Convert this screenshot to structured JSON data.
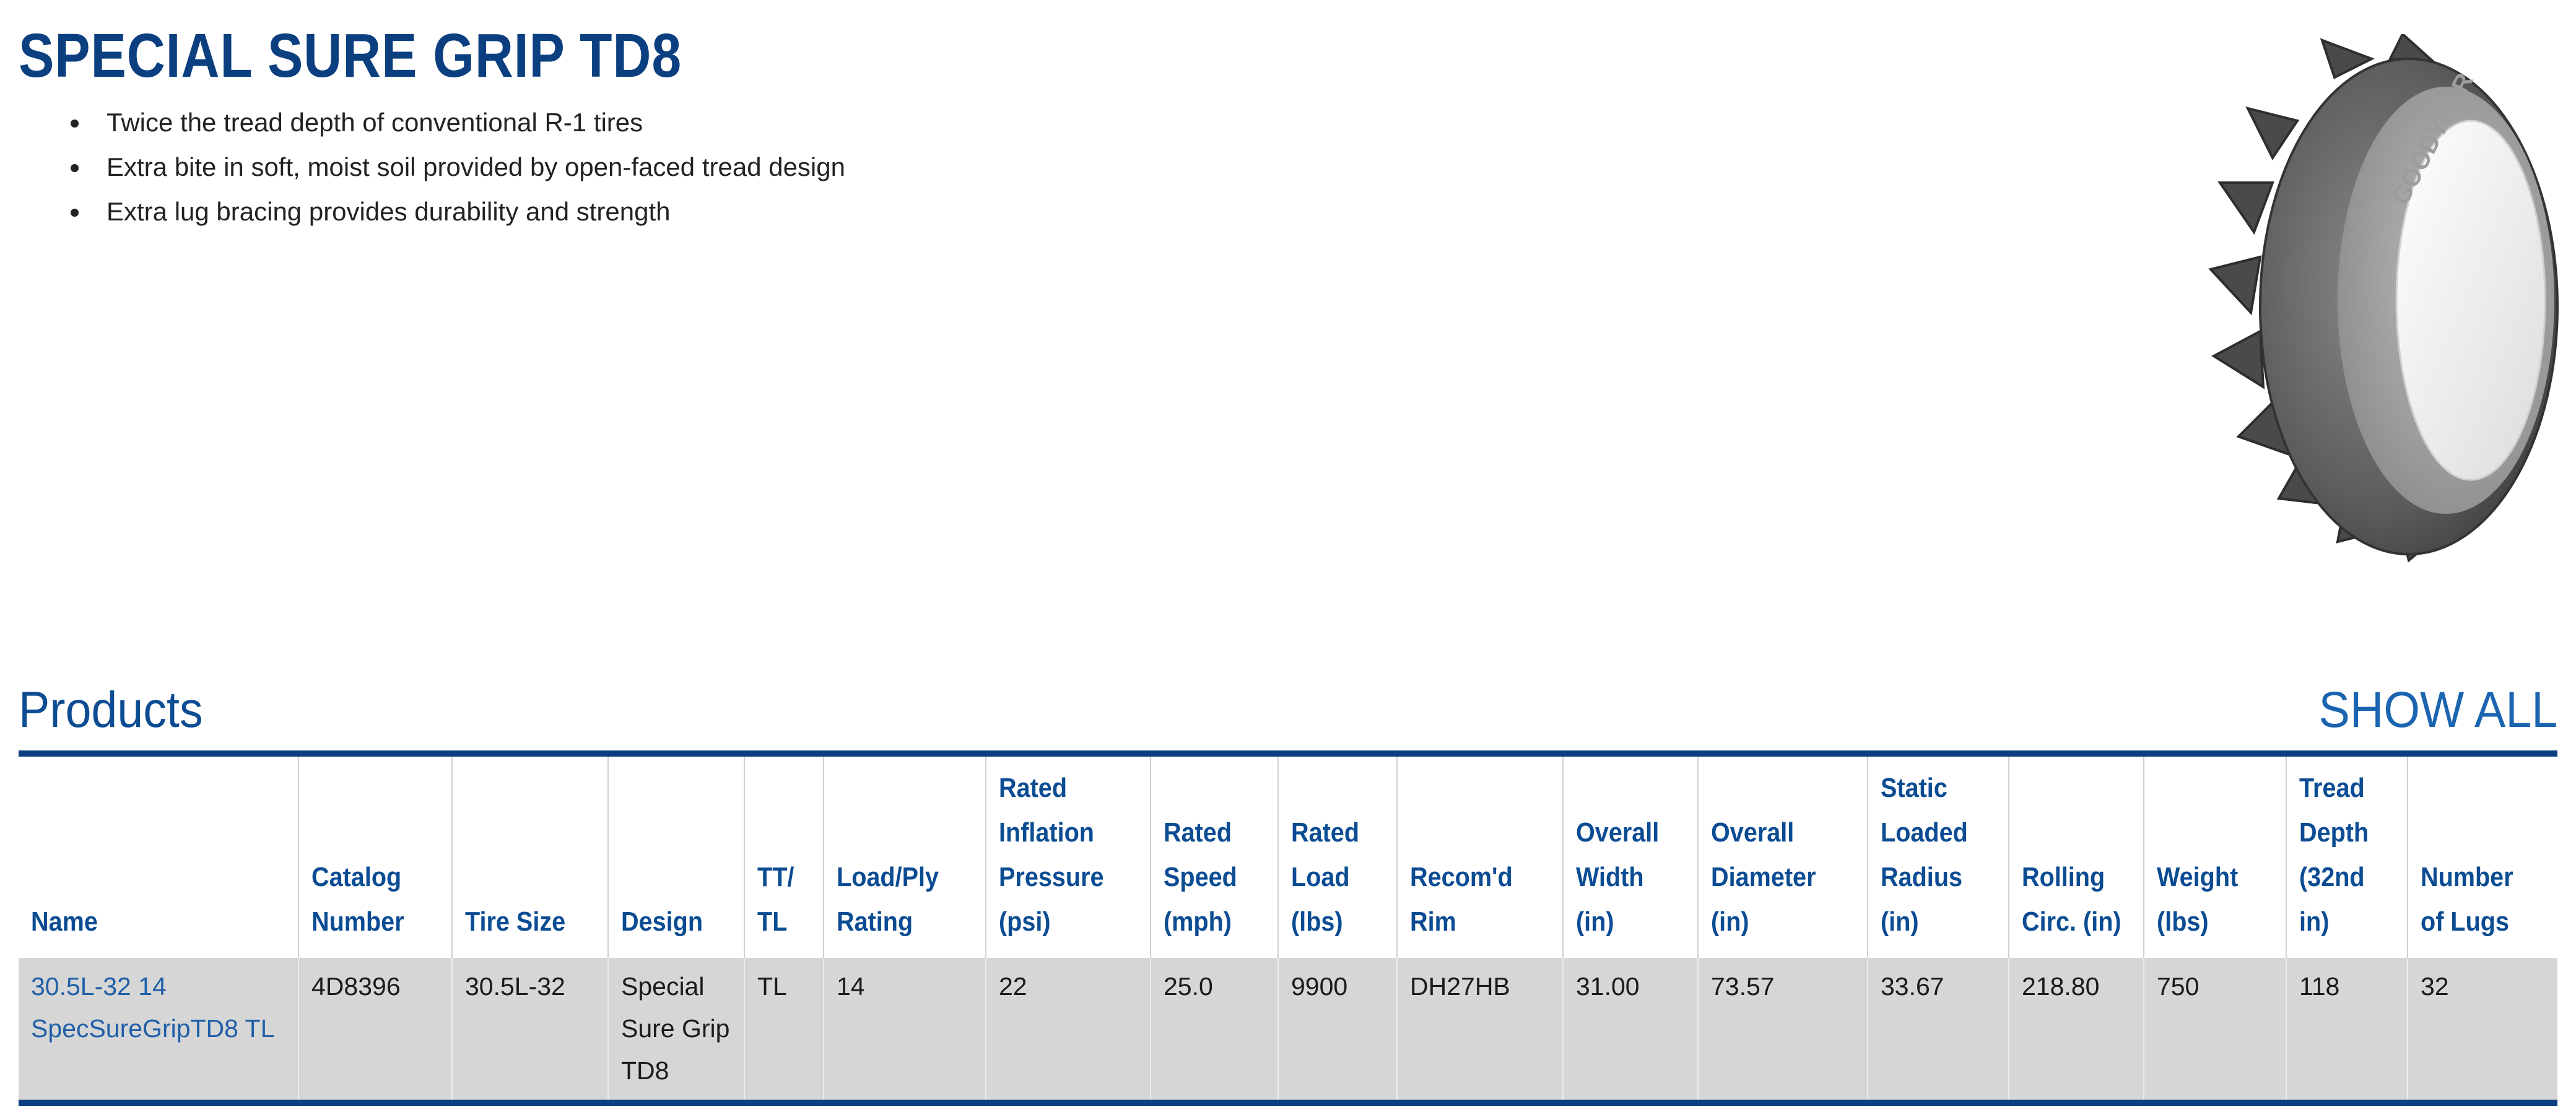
{
  "title": "SPECIAL SURE GRIP TD8",
  "features": [
    "Twice the tread depth of conventional R-1 tires",
    "Extra bite in soft, moist soil provided by open-faced tread design",
    "Extra lug bracing provides durability and strength"
  ],
  "image": {
    "icon": "tire-image",
    "sidewall_text": "GOODYEAR"
  },
  "products": {
    "heading": "Products",
    "show_all_label": "SHOW ALL",
    "columns": [
      "Name",
      "Catalog Number",
      "Tire Size",
      "Design",
      "TT/ TL",
      "Load/Ply Rating",
      "Rated Inflation Pressure (psi)",
      "Rated Speed (mph)",
      "Rated Load (lbs)",
      "Recom'd Rim",
      "Overall Width (in)",
      "Overall Diameter (in)",
      "Static Loaded Radius (in)",
      "Rolling Circ. (in)",
      "Weight (lbs)",
      "Tread Depth (32nd in)",
      "Number of Lugs"
    ],
    "rows": [
      {
        "cells": [
          "30.5L-32 14 SpecSureGripTD8 TL",
          "4D8396",
          "30.5L-32",
          "Special Sure Grip TD8",
          "TL",
          "14",
          "22",
          "25.0",
          "9900",
          "DH27HB",
          "31.00",
          "73.57",
          "33.67",
          "218.80",
          "750",
          "118",
          "32"
        ]
      }
    ]
  },
  "colors": {
    "heading_blue": "#0b3f7f",
    "link_blue": "#1f5fa8",
    "row_gray": "#d6d6d6"
  }
}
